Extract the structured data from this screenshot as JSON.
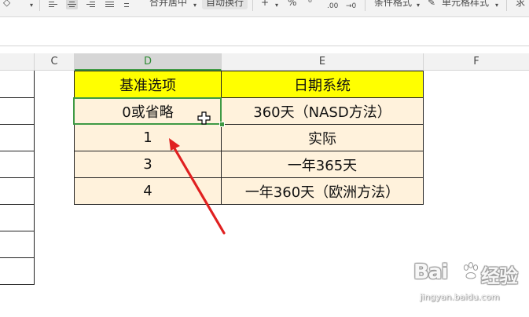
{
  "toolbar": {
    "merge_label": "合并居中",
    "wrap_label": "自动换行",
    "plus_label": "+",
    "percent_label": "%",
    "decrease_decimal_label": ".00",
    "increase_decimal_label": "→0",
    "conditional_format_label": "条件格式",
    "cell_style_label": "单元格样式",
    "more_label": "求"
  },
  "columns": {
    "c": "C",
    "d": "D",
    "e": "E",
    "f": "F"
  },
  "table": {
    "headers": [
      "基准选项",
      "日期系统"
    ],
    "rows": [
      [
        "0或省略",
        "360天（NASD方法）"
      ],
      [
        "1",
        "实际"
      ],
      [
        "3",
        "一年365天"
      ],
      [
        "4",
        "一年360天（欧洲方法）"
      ]
    ]
  },
  "colors": {
    "header_fill": "#ffff00",
    "body_fill": "#fff2dc",
    "selection": "#3f9a45",
    "arrow": "#e02020"
  },
  "watermark": {
    "brand": "Bai",
    "brand_suffix": "经验",
    "url": "jingyan.baidu.com"
  }
}
